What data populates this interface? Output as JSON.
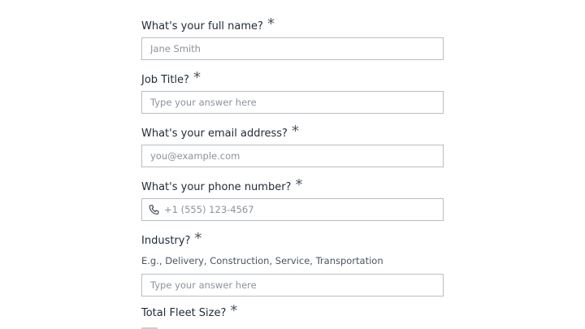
{
  "form": {
    "fields": [
      {
        "label": "What's your full name?",
        "required_mark": "*",
        "placeholder": "Jane Smith"
      },
      {
        "label": "Job Title?",
        "required_mark": "*",
        "placeholder": "Type your answer here"
      },
      {
        "label": "What's your email address?",
        "required_mark": "*",
        "placeholder": "you@example.com"
      },
      {
        "label": "What's your phone number?",
        "required_mark": "*",
        "placeholder": "+1 (555) 123-4567",
        "icon": "phone-icon"
      },
      {
        "label": "Industry?",
        "required_mark": "*",
        "hint": "E.g., Delivery, Construction, Service, Transportation",
        "placeholder": "Type your answer here"
      },
      {
        "label": "Total Fleet Size?",
        "required_mark": "*"
      }
    ]
  }
}
